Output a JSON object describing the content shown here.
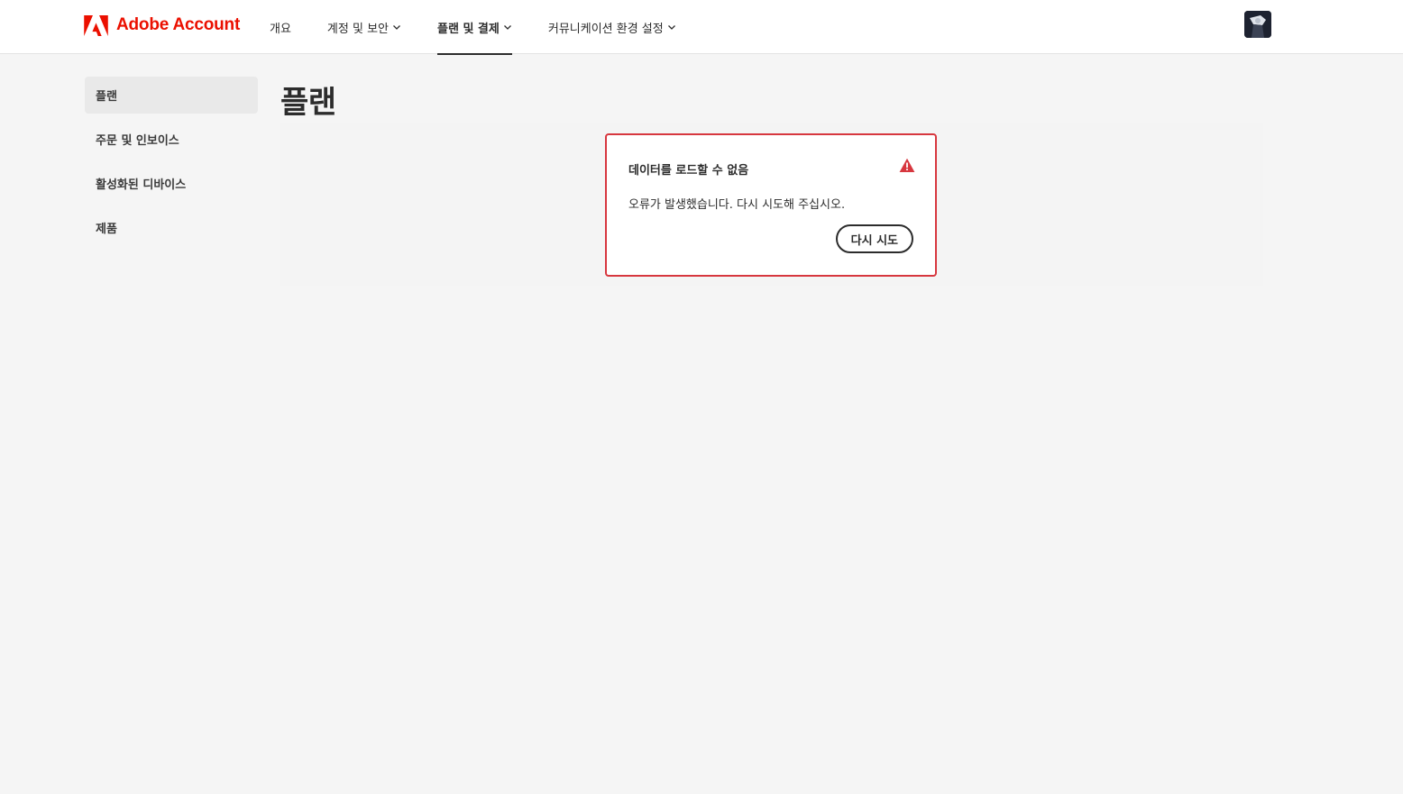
{
  "brand": {
    "name": "Adobe Account",
    "color": "#eb1000"
  },
  "nav": {
    "items": [
      {
        "label": "개요",
        "has_menu": false,
        "active": false
      },
      {
        "label": "계정 및 보안",
        "has_menu": true,
        "active": false
      },
      {
        "label": "플랜 및 결제",
        "has_menu": true,
        "active": true
      },
      {
        "label": "커뮤니케이션 환경 설정",
        "has_menu": true,
        "active": false
      }
    ]
  },
  "sidebar": {
    "items": [
      {
        "label": "플랜",
        "active": true
      },
      {
        "label": "주문 및 인보이스",
        "active": false
      },
      {
        "label": "활성화된 디바이스",
        "active": false
      },
      {
        "label": "제품",
        "active": false
      }
    ]
  },
  "page": {
    "title": "플랜"
  },
  "alert": {
    "title": "데이터를 로드할 수 없음",
    "message": "오류가 발생했습니다. 다시 시도해 주십시오.",
    "button_label": "다시 시도",
    "icon": "alert-triangle-icon",
    "color": "#d7373f"
  }
}
